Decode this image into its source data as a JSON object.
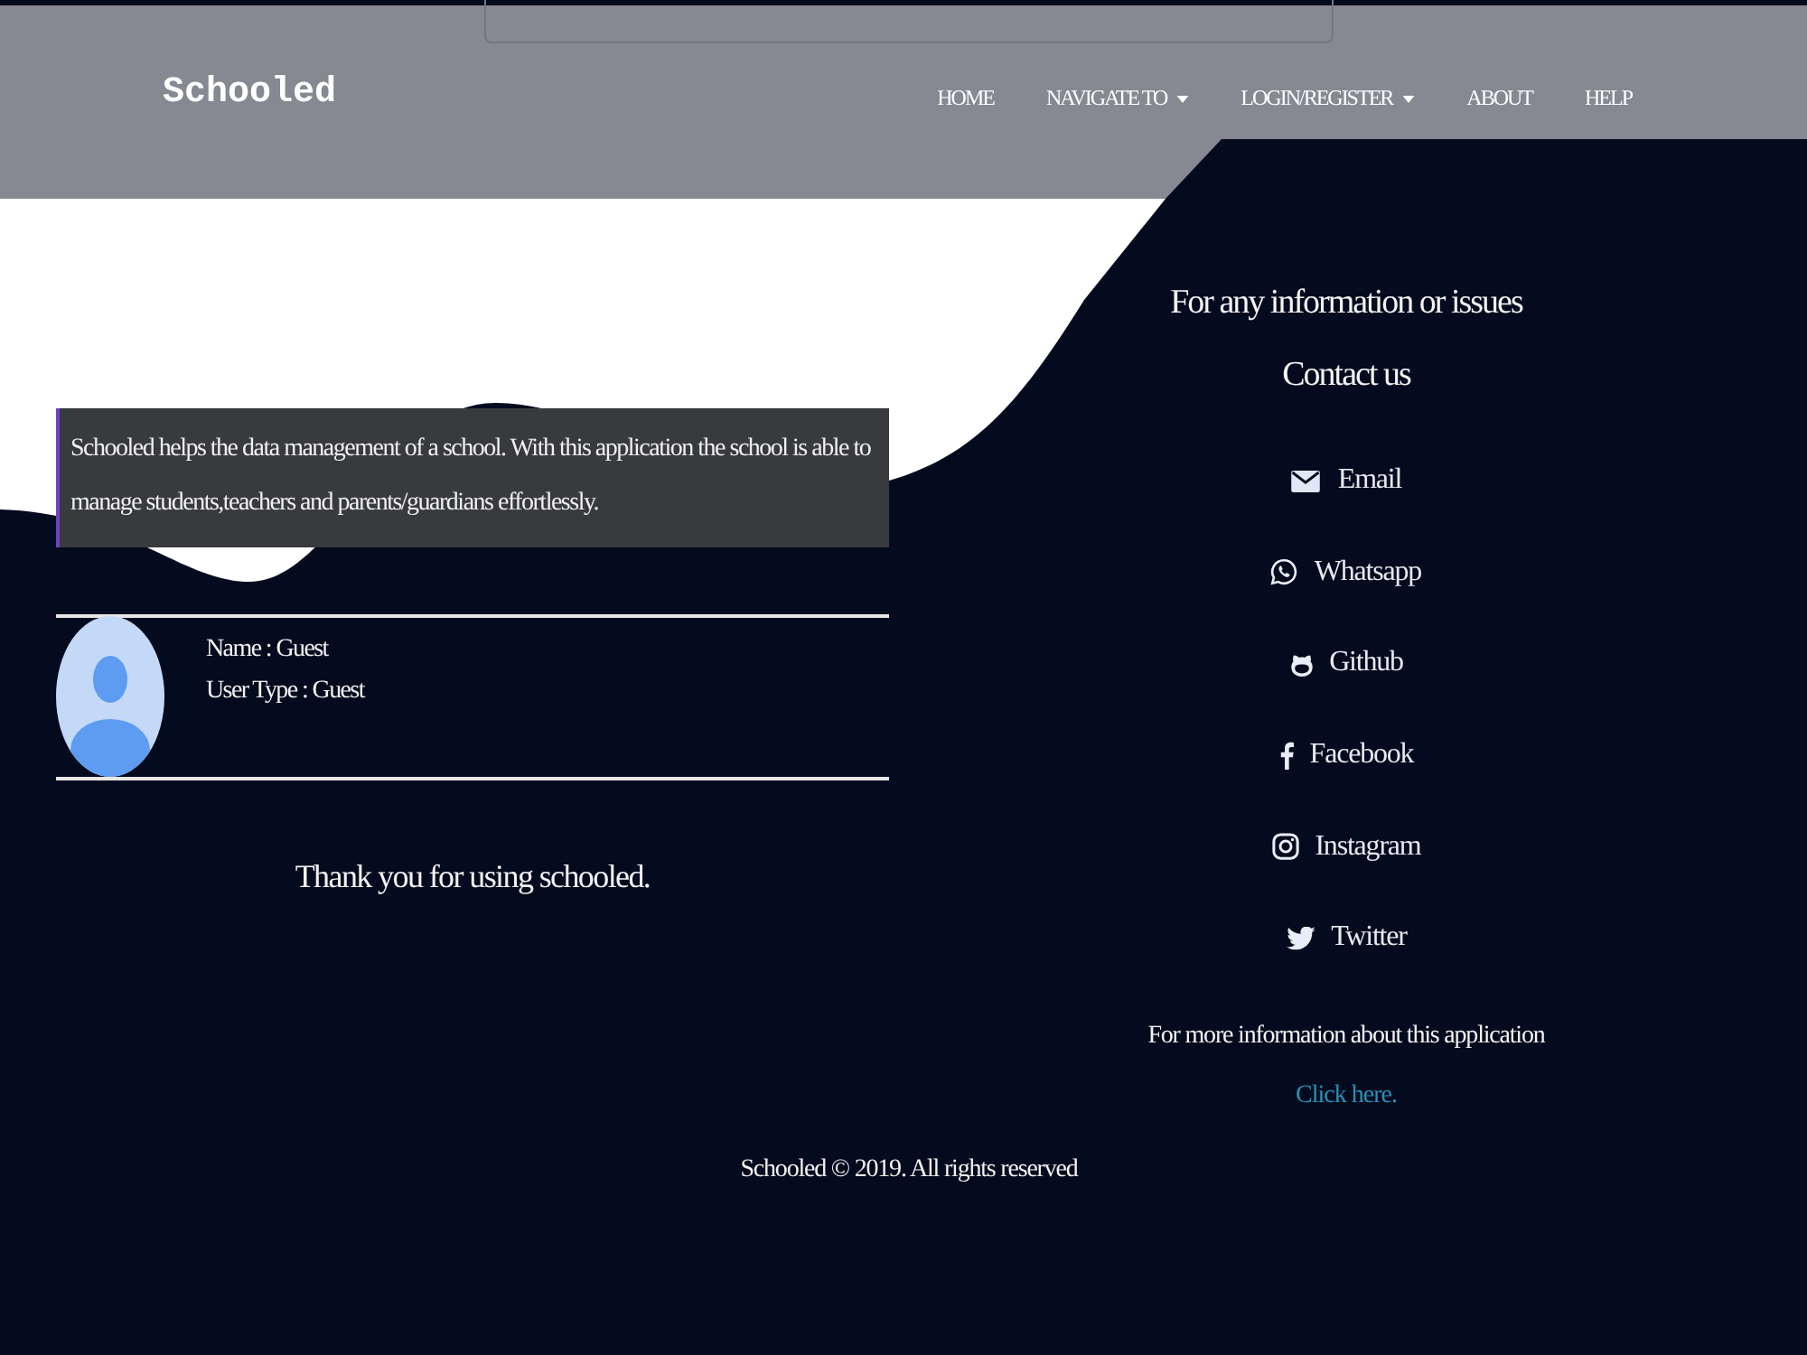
{
  "navbar": {
    "brand": "Schooled",
    "items": [
      {
        "label": "HOME",
        "dropdown": false
      },
      {
        "label": "NAVIGATE TO",
        "dropdown": true
      },
      {
        "label": "LOGIN/REGISTER",
        "dropdown": true
      },
      {
        "label": "ABOUT",
        "dropdown": false
      },
      {
        "label": "HELP",
        "dropdown": false
      }
    ]
  },
  "about": {
    "text": "Schooled helps the data management of a school. With this application the school is able to manage students,teachers and parents/guardians effortlessly."
  },
  "profile": {
    "name": "Name : Guest",
    "user_type": "User Type : Guest"
  },
  "thanks": "Thank you for using schooled.",
  "contact": {
    "heading": "For any information or issues",
    "subheading": "Contact us",
    "links": [
      {
        "kind": "email",
        "label": "Email"
      },
      {
        "kind": "whatsapp",
        "label": "Whatsapp"
      },
      {
        "kind": "github",
        "label": "Github"
      },
      {
        "kind": "facebook",
        "label": "Facebook"
      },
      {
        "kind": "instagram",
        "label": "Instagram"
      },
      {
        "kind": "twitter",
        "label": "Twitter"
      }
    ]
  },
  "more_info": {
    "text": "For more information about this application",
    "link": "Click here."
  },
  "footer": {
    "copyright": "Schooled © 2019. All rights reserved"
  }
}
